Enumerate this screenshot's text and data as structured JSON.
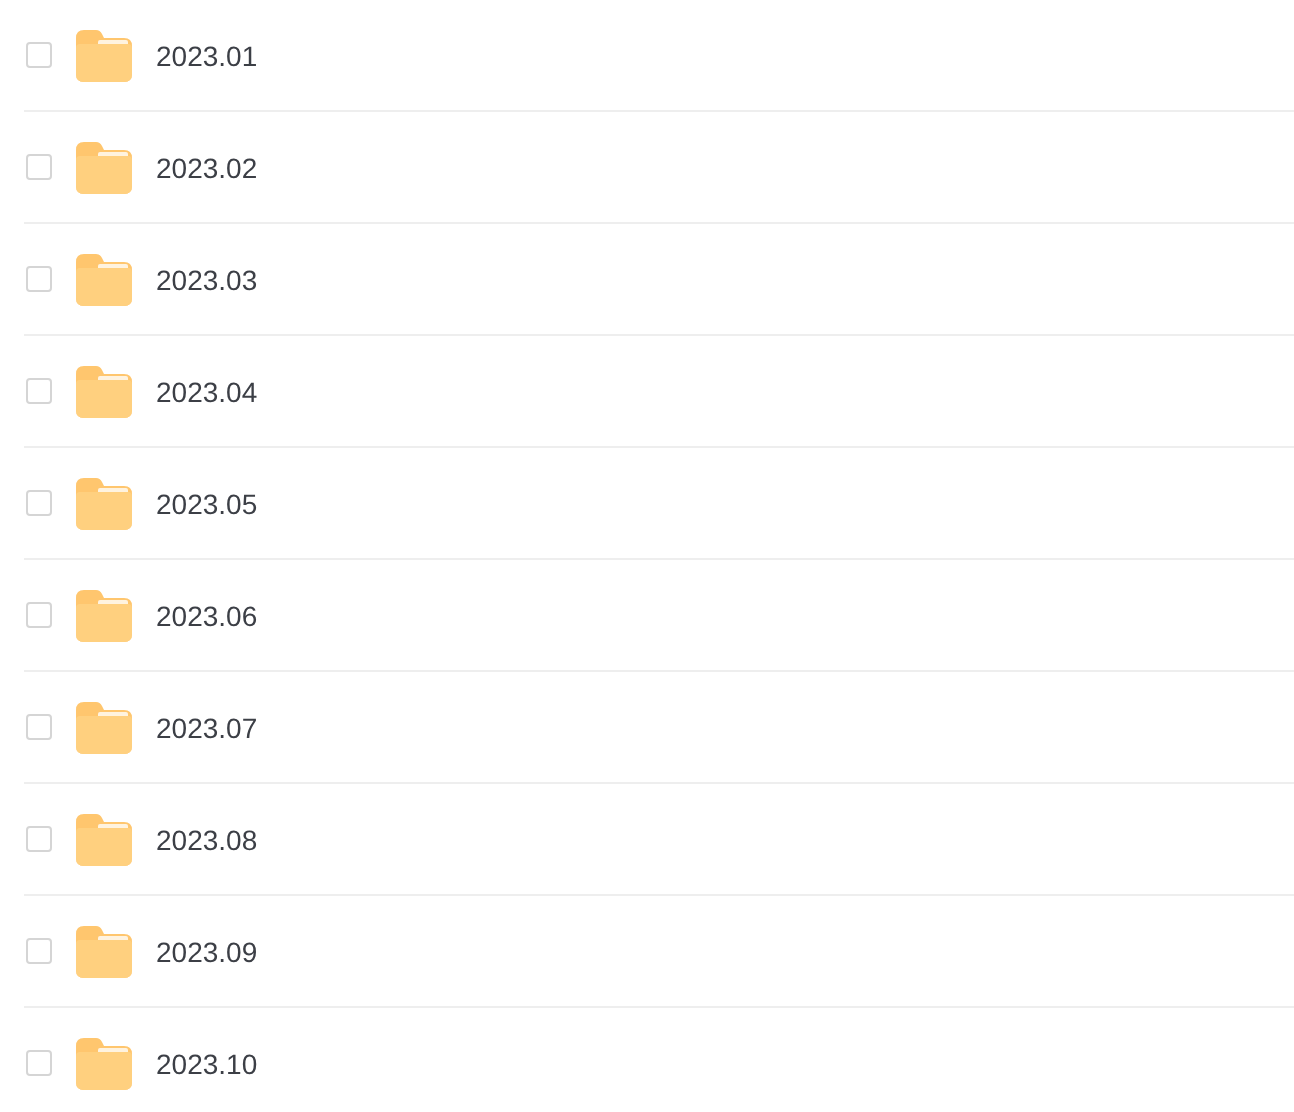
{
  "files": [
    {
      "name": "2023.01",
      "checked": false
    },
    {
      "name": "2023.02",
      "checked": false
    },
    {
      "name": "2023.03",
      "checked": false
    },
    {
      "name": "2023.04",
      "checked": false
    },
    {
      "name": "2023.05",
      "checked": false
    },
    {
      "name": "2023.06",
      "checked": false
    },
    {
      "name": "2023.07",
      "checked": false
    },
    {
      "name": "2023.08",
      "checked": false
    },
    {
      "name": "2023.09",
      "checked": false
    },
    {
      "name": "2023.10",
      "checked": false
    }
  ]
}
